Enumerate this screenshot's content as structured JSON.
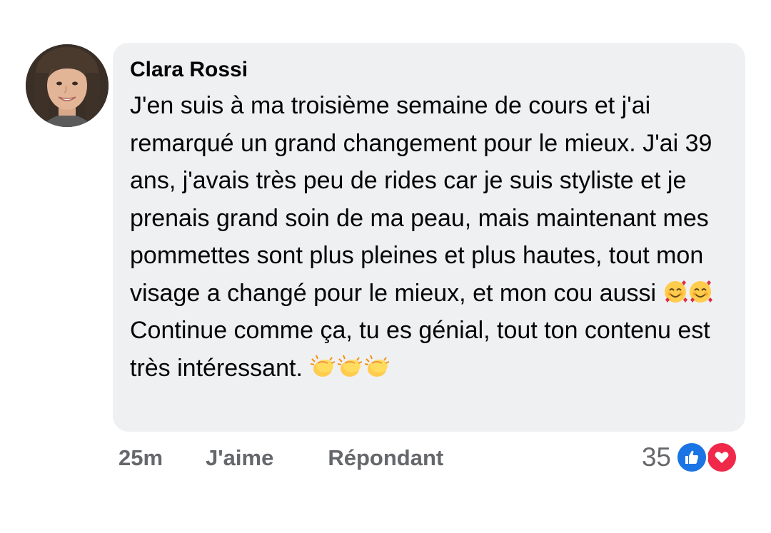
{
  "comment": {
    "author": "Clara Rossi",
    "paragraphs": [
      "J'en suis à ma troisième semaine de cours et j'ai remarqué un grand changement pour le mieux. J'ai 39 ans, j'avais très peu de rides car je suis styliste et je prenais grand soin de ma peau, mais maintenant mes pommettes sont plus pleines et plus hautes, tout mon visage a changé pour le mieux, et mon cou aussi",
      "Continue comme ça, tu es génial, tout ton contenu est très intéressant."
    ],
    "emojis": {
      "first": [
        "smiling-face-with-hearts-icon",
        "smiling-face-with-hearts-icon"
      ],
      "second": [
        "clapping-hands-icon",
        "clapping-hands-icon",
        "clapping-hands-icon"
      ]
    }
  },
  "actions": {
    "time": "25m",
    "like_label": "J'aime",
    "reply_label": "Répondant"
  },
  "reactions": {
    "count": "35",
    "icons": [
      "like-reaction-icon",
      "love-reaction-icon"
    ]
  },
  "colors": {
    "bubble_bg": "#eff0f2",
    "meta_text": "#65676b",
    "like_blue": "#1b74e4",
    "love_red": "#f0284a"
  }
}
